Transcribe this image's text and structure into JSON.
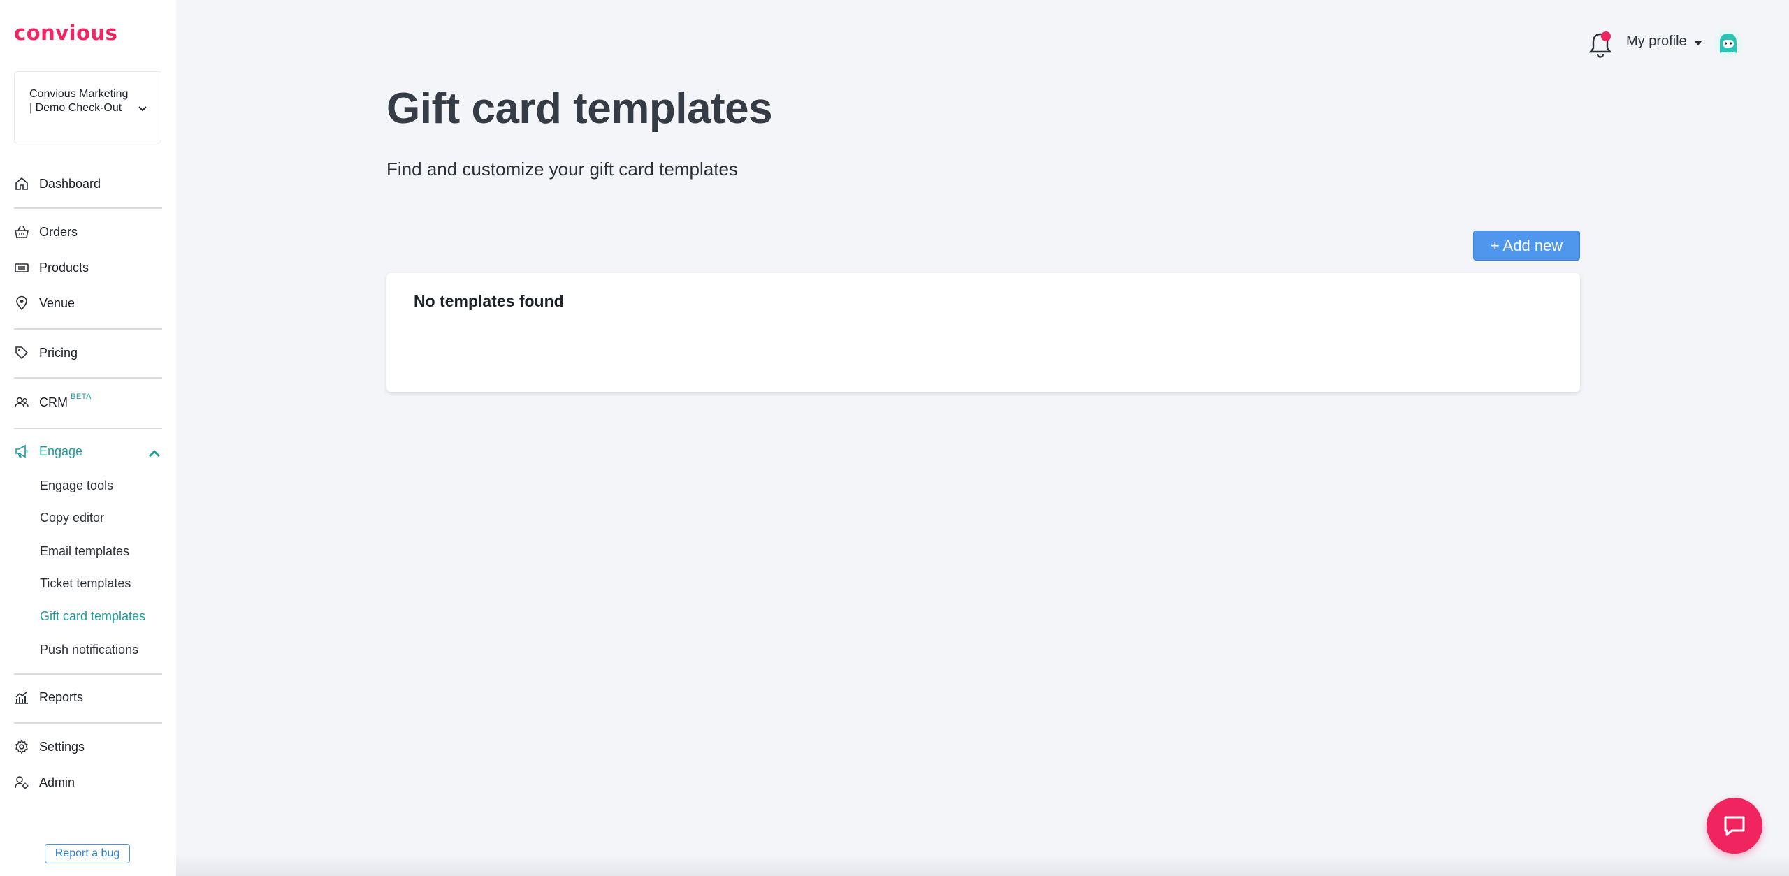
{
  "brand": {
    "logo_text": "convious",
    "accent": "#f0245f",
    "teal": "#1a9e9b",
    "blue": "#4f97ec"
  },
  "sidebar": {
    "account": "Convious Marketing | Demo Check-Out",
    "items": [
      {
        "label": "Dashboard",
        "icon": "home-icon"
      },
      {
        "label": "Orders",
        "icon": "basket-icon"
      },
      {
        "label": "Products",
        "icon": "ticket-icon"
      },
      {
        "label": "Venue",
        "icon": "location-pin-icon"
      },
      {
        "label": "Pricing",
        "icon": "tag-icon"
      },
      {
        "label": "CRM",
        "icon": "users-icon",
        "badge": "BETA"
      },
      {
        "label": "Engage",
        "icon": "megaphone-icon",
        "active": true
      },
      {
        "label": "Reports",
        "icon": "chart-icon"
      },
      {
        "label": "Settings",
        "icon": "gear-icon"
      },
      {
        "label": "Admin",
        "icon": "user-gear-icon"
      }
    ],
    "engage_sub": [
      {
        "label": "Engage tools"
      },
      {
        "label": "Copy editor"
      },
      {
        "label": "Email templates"
      },
      {
        "label": "Ticket templates"
      },
      {
        "label": "Gift card templates",
        "active": true
      },
      {
        "label": "Push notifications"
      }
    ],
    "report_bug": "Report a bug"
  },
  "header": {
    "profile_label": "My profile"
  },
  "main": {
    "title": "Gift card templates",
    "subtitle": "Find and customize your gift card templates",
    "add_button": "+ Add new",
    "empty_message": "No templates found"
  }
}
